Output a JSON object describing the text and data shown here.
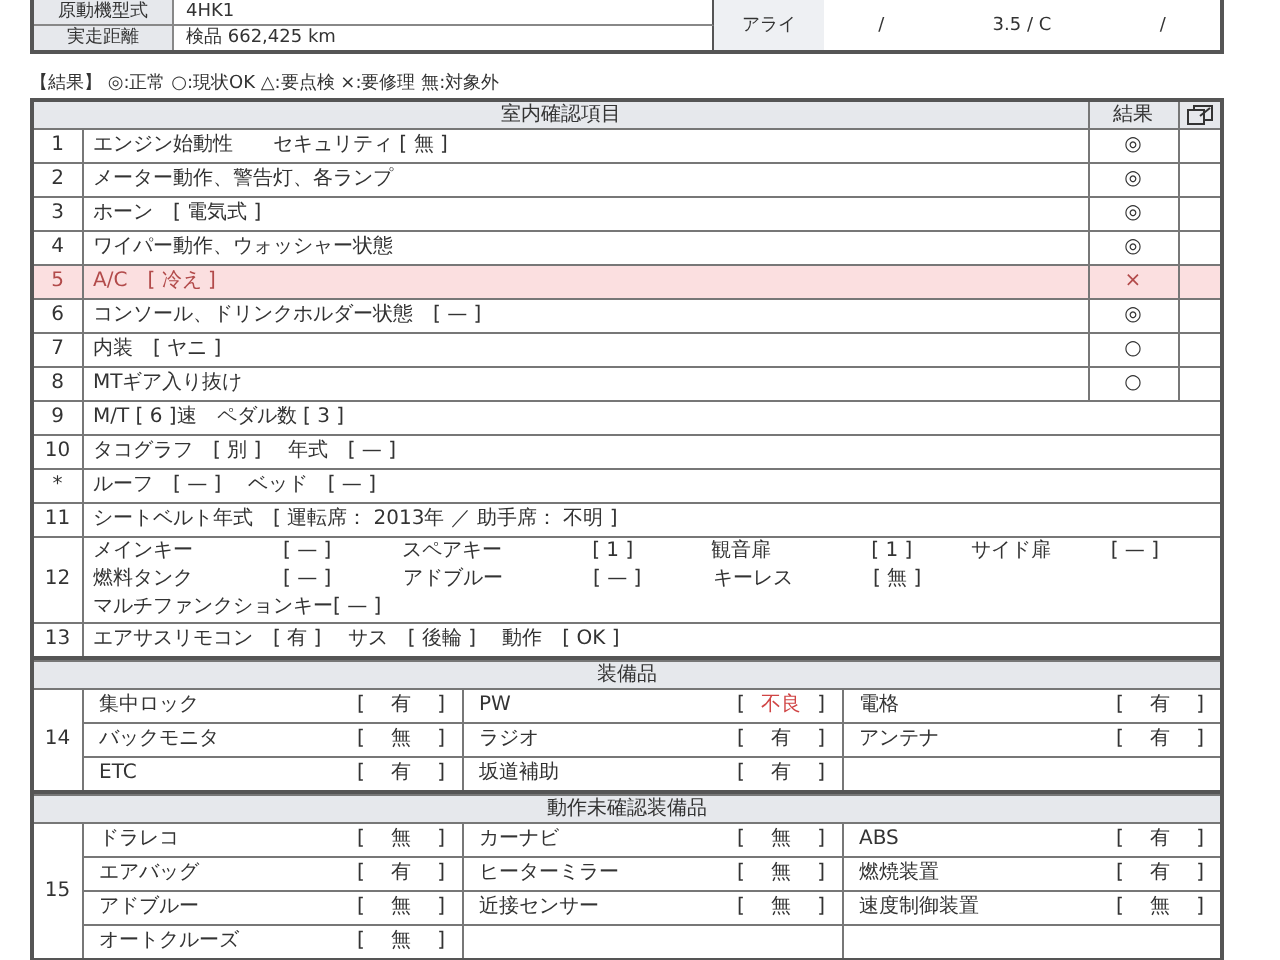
{
  "vehicle_info": {
    "rows": [
      {
        "label": "原動機型式",
        "value": "4HK1"
      },
      {
        "label": "実走距離",
        "value": "検品 662,425 km"
      }
    ],
    "side": {
      "label": "アライ",
      "values": [
        "/",
        "3.5 / C",
        "/"
      ]
    }
  },
  "legend": "【結果】 ◎:正常  ○:現状OK  △:要点検  ×:要修理  無:対象外",
  "brackets": [
    "[",
    "]"
  ],
  "interior": {
    "title": "室内確認項目",
    "result_header": "結果",
    "items": [
      {
        "kind": "result",
        "number": "1",
        "text": "エンジン始動性　　セキュリティ [ 無 ]",
        "result": "◎",
        "flagged": false
      },
      {
        "kind": "result",
        "number": "2",
        "text": "メーター動作、警告灯、各ランプ",
        "result": "◎",
        "flagged": false
      },
      {
        "kind": "result",
        "number": "3",
        "text": "ホーン　[ 電気式 ]",
        "result": "◎",
        "flagged": false
      },
      {
        "kind": "result",
        "number": "4",
        "text": "ワイパー動作、ウォッシャー状態",
        "result": "◎",
        "flagged": false
      },
      {
        "kind": "result",
        "number": "5",
        "text": "A/C　[ 冷え ]",
        "result": "×",
        "flagged": true
      },
      {
        "kind": "result",
        "number": "6",
        "text": "コンソール、ドリンクホルダー状態　[ — ]",
        "result": "◎",
        "flagged": false
      },
      {
        "kind": "result",
        "number": "7",
        "text": "内装　[ ヤニ ]",
        "result": "○",
        "flagged": false
      },
      {
        "kind": "result",
        "number": "8",
        "text": "MTギア入り抜け",
        "result": "○",
        "flagged": false
      },
      {
        "kind": "wide",
        "number": "9",
        "text": "M/T [ 6 ]速　ペダル数 [ 3 ]"
      },
      {
        "kind": "wide",
        "number": "10",
        "text": "タコグラフ　[ 別 ]　 年式　[ — ]"
      },
      {
        "kind": "wide",
        "number": "*",
        "text": "ルーフ　[ — ]　 ベッド　[ — ]"
      },
      {
        "kind": "wide",
        "number": "11",
        "text": "シートベルト年式　[ 運転席： 2013年 ／ 助手席： 不明 ]"
      },
      {
        "kind": "grid",
        "number": "12",
        "lines": [
          [
            {
              "label": "メインキー",
              "value": "[ — ]"
            },
            {
              "label": "スペアキー",
              "value": "[ 1 ]"
            },
            {
              "label": "観音扉",
              "value": "[ 1 ]"
            },
            {
              "label": "サイド扉",
              "value": "[ — ]"
            }
          ],
          [
            {
              "label": "燃料タンク",
              "value": "[ — ]"
            },
            {
              "label": "アドブルー",
              "value": "[ — ]"
            },
            {
              "label": "キーレス",
              "value": "[ 無 ]"
            }
          ],
          [
            {
              "label": "マルチファンクションキー",
              "value": "[ — ]"
            }
          ]
        ]
      },
      {
        "kind": "wide",
        "number": "13",
        "text": "エアサスリモコン　[ 有 ]　 サス　[ 後輪 ]　 動作　[ OK ]"
      }
    ]
  },
  "equipment": [
    {
      "title": "装備品",
      "number": "14",
      "rows": [
        [
          {
            "label": "集中ロック",
            "value": "有",
            "bad": false
          },
          {
            "label": "PW",
            "value": "不良",
            "bad": true
          },
          {
            "label": "電格",
            "value": "有",
            "bad": false
          }
        ],
        [
          {
            "label": "バックモニタ",
            "value": "無",
            "bad": false
          },
          {
            "label": "ラジオ",
            "value": "有",
            "bad": false
          },
          {
            "label": "アンテナ",
            "value": "有",
            "bad": false
          }
        ],
        [
          {
            "label": "ETC",
            "value": "有",
            "bad": false
          },
          {
            "label": "坂道補助",
            "value": "有",
            "bad": false
          }
        ]
      ]
    },
    {
      "title": "動作未確認装備品",
      "number": "15",
      "rows": [
        [
          {
            "label": "ドラレコ",
            "value": "無",
            "bad": false
          },
          {
            "label": "カーナビ",
            "value": "無",
            "bad": false
          },
          {
            "label": "ABS",
            "value": "有",
            "bad": false
          }
        ],
        [
          {
            "label": "エアバッグ",
            "value": "有",
            "bad": false
          },
          {
            "label": "ヒーターミラー",
            "value": "無",
            "bad": false
          },
          {
            "label": "燃焼装置",
            "value": "有",
            "bad": false
          }
        ],
        [
          {
            "label": "アドブルー",
            "value": "無",
            "bad": false
          },
          {
            "label": "近接センサー",
            "value": "無",
            "bad": false
          },
          {
            "label": "速度制御装置",
            "value": "無",
            "bad": false
          }
        ],
        [
          {
            "label": "オートクルーズ",
            "value": "無",
            "bad": false
          }
        ]
      ]
    }
  ]
}
